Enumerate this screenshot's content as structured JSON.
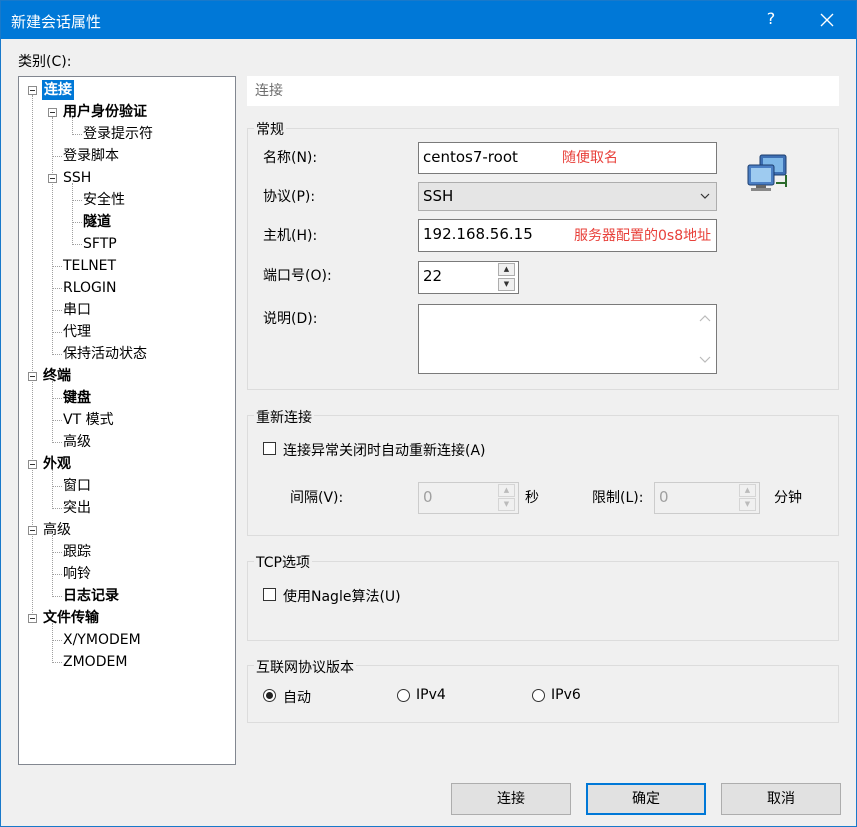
{
  "window": {
    "title": "新建会话属性",
    "help_glyph": "?",
    "close_glyph": "✕"
  },
  "category_label": "类别(C):",
  "tree": {
    "items": [
      {
        "label": "连接",
        "bold": true,
        "selected": true
      },
      {
        "label": "用户身份验证",
        "bold": true
      },
      {
        "label": "登录提示符"
      },
      {
        "label": "登录脚本"
      },
      {
        "label": "SSH"
      },
      {
        "label": "安全性"
      },
      {
        "label": "隧道",
        "bold": true
      },
      {
        "label": "SFTP"
      },
      {
        "label": "TELNET"
      },
      {
        "label": "RLOGIN"
      },
      {
        "label": "串口"
      },
      {
        "label": "代理"
      },
      {
        "label": "保持活动状态"
      },
      {
        "label": "终端",
        "bold": true
      },
      {
        "label": "键盘",
        "bold": true
      },
      {
        "label": "VT 模式"
      },
      {
        "label": "高级"
      },
      {
        "label": "外观",
        "bold": true
      },
      {
        "label": "窗口"
      },
      {
        "label": "突出"
      },
      {
        "label": "高级"
      },
      {
        "label": "跟踪"
      },
      {
        "label": "响铃"
      },
      {
        "label": "日志记录",
        "bold": true
      },
      {
        "label": "文件传输",
        "bold": true
      },
      {
        "label": "X/YMODEM"
      },
      {
        "label": "ZMODEM"
      }
    ]
  },
  "section_header": "连接",
  "general": {
    "title": "常规",
    "name_label": "名称(N):",
    "name_value": "centos7-root",
    "name_note": "随便取名",
    "protocol_label": "协议(P):",
    "protocol_value": "SSH",
    "host_label": "主机(H):",
    "host_value": "192.168.56.15",
    "host_note": "服务器配置的0s8地址",
    "port_label": "端口号(O):",
    "port_value": "22",
    "desc_label": "说明(D):",
    "desc_value": ""
  },
  "reconnect": {
    "title": "重新连接",
    "checkbox_label": "连接异常关闭时自动重新连接(A)",
    "checked": false,
    "interval_label": "间隔(V):",
    "interval_value": "0",
    "interval_unit": "秒",
    "limit_label": "限制(L):",
    "limit_value": "0",
    "limit_unit": "分钟"
  },
  "tcp": {
    "title": "TCP选项",
    "nagle_label": "使用Nagle算法(U)",
    "checked": false
  },
  "ip_version": {
    "title": "互联网协议版本",
    "options": [
      "自动",
      "IPv4",
      "IPv6"
    ],
    "selected": "自动"
  },
  "buttons": {
    "connect": "连接",
    "ok": "确定",
    "cancel": "取消"
  },
  "colors": {
    "titlebar": "#0078d7",
    "selection": "#0078d7",
    "note_red": "#e8403a"
  }
}
